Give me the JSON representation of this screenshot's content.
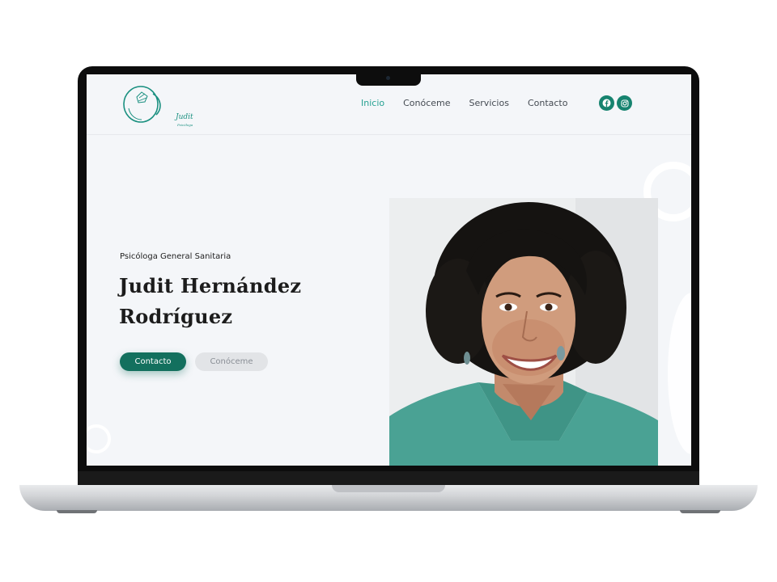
{
  "header": {
    "logo": {
      "name": "Judit",
      "sub": "Psicóloga"
    },
    "nav": [
      {
        "label": "Inicio",
        "active": true
      },
      {
        "label": "Conóceme",
        "active": false
      },
      {
        "label": "Servicios",
        "active": false
      },
      {
        "label": "Contacto",
        "active": false
      }
    ],
    "social": [
      {
        "icon": "facebook-icon"
      },
      {
        "icon": "instagram-icon"
      }
    ]
  },
  "hero": {
    "subtitle": "Psicóloga General Sanitaria",
    "title_line1": "Judit Hernández",
    "title_line2": "Rodríguez",
    "primary_button": "Contacto",
    "secondary_button": "Conóceme"
  },
  "colors": {
    "accent": "#13705e",
    "nav_active": "#26a192",
    "background": "#f4f6f9"
  }
}
